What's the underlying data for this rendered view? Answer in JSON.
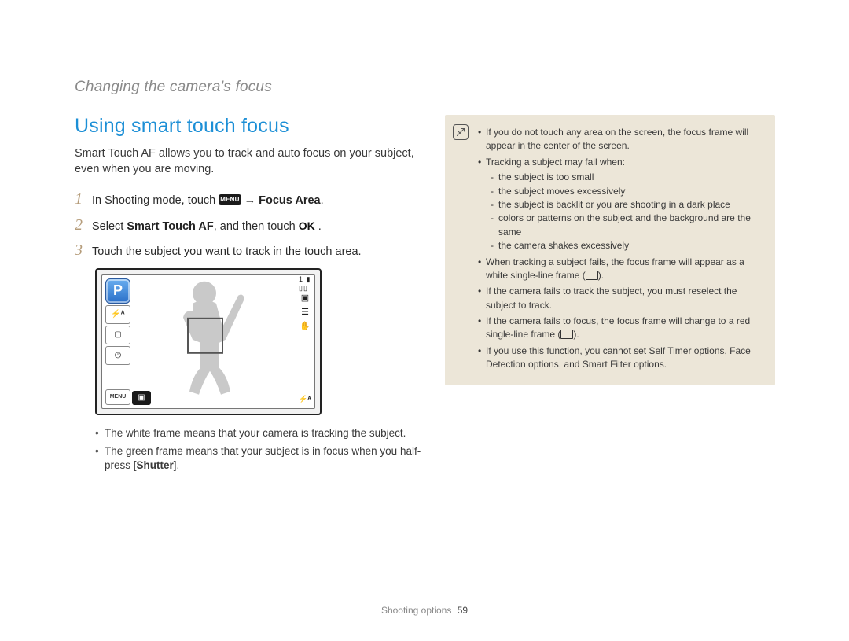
{
  "header": {
    "breadcrumb": "Changing the camera's focus"
  },
  "section": {
    "title": "Using smart touch focus",
    "intro": "Smart Touch AF allows you to track and auto focus on your subject, even when you are moving."
  },
  "steps": {
    "n1": "1",
    "s1_pre": "In Shooting mode, touch ",
    "s1_menu": "MENU",
    "s1_arrow": " → ",
    "s1_bold": "Focus Area",
    "s1_post": ".",
    "n2": "2",
    "s2_pre": "Select ",
    "s2_bold": "Smart Touch AF",
    "s2_mid": ", and then touch ",
    "s2_ok": "OK",
    "s2_post": " .",
    "n3": "3",
    "s3": "Touch the subject you want to track in the touch area."
  },
  "lcd": {
    "p": "P",
    "flash": "⚡ᴬ",
    "af_square": "▢",
    "timer": "◷",
    "menu": "MENU",
    "thumb": "▣",
    "top_right": "1 ▮ ▯▯",
    "r2": "▣",
    "r3": "☰",
    "r4": "✋",
    "r5": "⚡ᴬ"
  },
  "frame_notes": {
    "n1_pre": "The white frame means that your camera is tracking the subject.",
    "n2_pre": "The green frame means that your subject is in focus when you half-press [",
    "n2_bold": "Shutter",
    "n2_post": "]."
  },
  "info": {
    "b1": "If you do not touch any area on the screen, the focus frame will appear in the center of the screen.",
    "b2": "Tracking a subject may fail when:",
    "b2s1": "the subject is too small",
    "b2s2": "the subject moves excessively",
    "b2s3": "the subject is backlit or you are shooting in a dark place",
    "b2s4": "colors or patterns on the subject and the background are the same",
    "b2s5": "the camera shakes excessively",
    "b3_pre": "When tracking a subject fails, the focus frame will appear as a white single-line frame (",
    "b3_post": ").",
    "b4": "If the camera fails to track the subject, you must reselect the subject to track.",
    "b5_pre": "If the camera fails to focus, the focus frame will change to a red single-line frame (",
    "b5_post": ").",
    "b6": "If you use this function, you cannot set Self Timer options, Face Detection options, and Smart Filter options."
  },
  "footer": {
    "section": "Shooting options",
    "page": "59"
  }
}
